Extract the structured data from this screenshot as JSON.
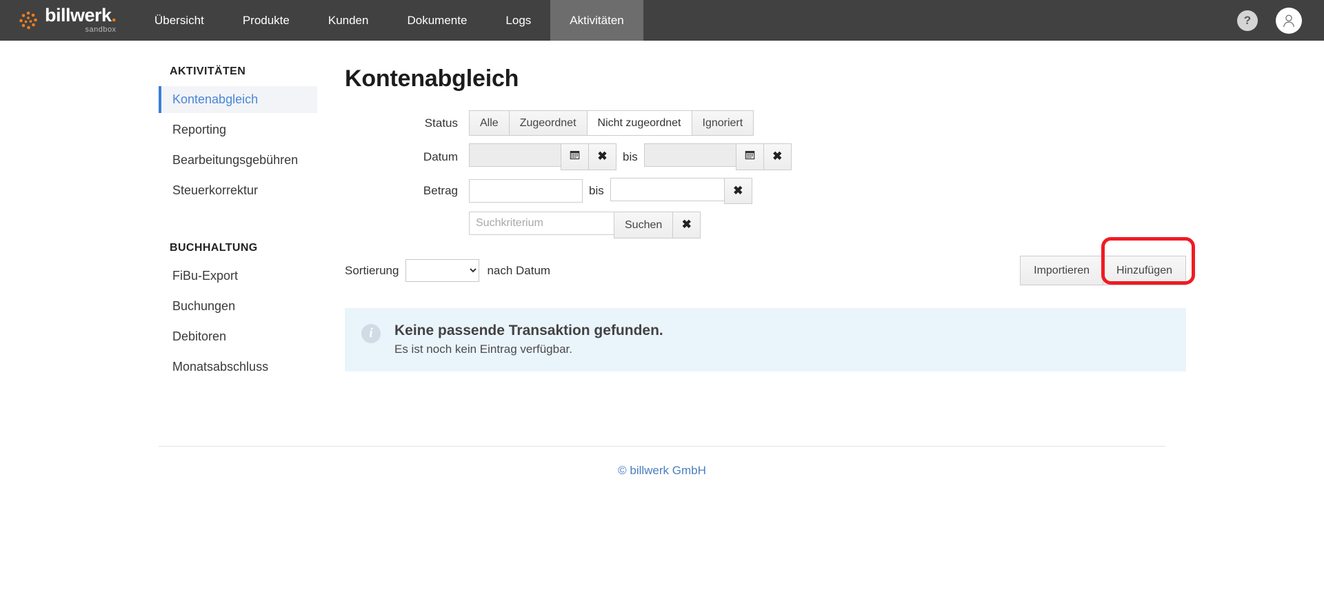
{
  "brand": {
    "name": "billwerk",
    "dot": ".",
    "environment": "sandbox",
    "accent_color": "#f07c1e"
  },
  "topnav": {
    "items": [
      {
        "label": "Übersicht",
        "active": false
      },
      {
        "label": "Produkte",
        "active": false
      },
      {
        "label": "Kunden",
        "active": false
      },
      {
        "label": "Dokumente",
        "active": false
      },
      {
        "label": "Logs",
        "active": false
      },
      {
        "label": "Aktivitäten",
        "active": true
      }
    ],
    "help_label": "?",
    "avatar_label": "user-avatar"
  },
  "sidebar": {
    "section_one": {
      "heading": "AKTIVITÄTEN",
      "items": [
        {
          "label": "Kontenabgleich",
          "active": true
        },
        {
          "label": "Reporting",
          "active": false
        },
        {
          "label": "Bearbeitungsgebühren",
          "active": false
        },
        {
          "label": "Steuerkorrektur",
          "active": false
        }
      ]
    },
    "section_two": {
      "heading": "BUCHHALTUNG",
      "items": [
        {
          "label": "FiBu-Export",
          "active": false
        },
        {
          "label": "Buchungen",
          "active": false
        },
        {
          "label": "Debitoren",
          "active": false
        },
        {
          "label": "Monatsabschluss",
          "active": false
        }
      ]
    },
    "active_color": "#3b7fd4"
  },
  "main": {
    "title": "Kontenabgleich",
    "filters": {
      "status": {
        "label": "Status",
        "options": [
          {
            "label": "Alle",
            "selected": false
          },
          {
            "label": "Zugeordnet",
            "selected": false
          },
          {
            "label": "Nicht zugeordnet",
            "selected": true
          },
          {
            "label": "Ignoriert",
            "selected": false
          }
        ]
      },
      "datum": {
        "label": "Datum",
        "from_value": "",
        "to_value": "",
        "between_label": "bis",
        "calendar_icon": "calendar-icon",
        "clear_icon": "✖"
      },
      "betrag": {
        "label": "Betrag",
        "from_value": "",
        "to_value": "",
        "between_label": "bis",
        "clear_icon": "✖"
      },
      "suche": {
        "placeholder": "Suchkriterium",
        "value": "",
        "search_label": "Suchen",
        "clear_icon": "✖"
      }
    },
    "sorting": {
      "label": "Sortierung",
      "selected_value": "",
      "options": [
        ""
      ],
      "suffix": "nach Datum"
    },
    "actions": {
      "import_label": "Importieren",
      "add_label": "Hinzufügen",
      "highlight_color": "#ef1b24"
    },
    "alert": {
      "icon": "info-icon",
      "title": "Keine passende Transaktion gefunden.",
      "subtitle": "Es ist noch kein Eintrag verfügbar."
    }
  },
  "footer": {
    "text": "© billwerk GmbH",
    "link_color": "#4a7ec0"
  }
}
